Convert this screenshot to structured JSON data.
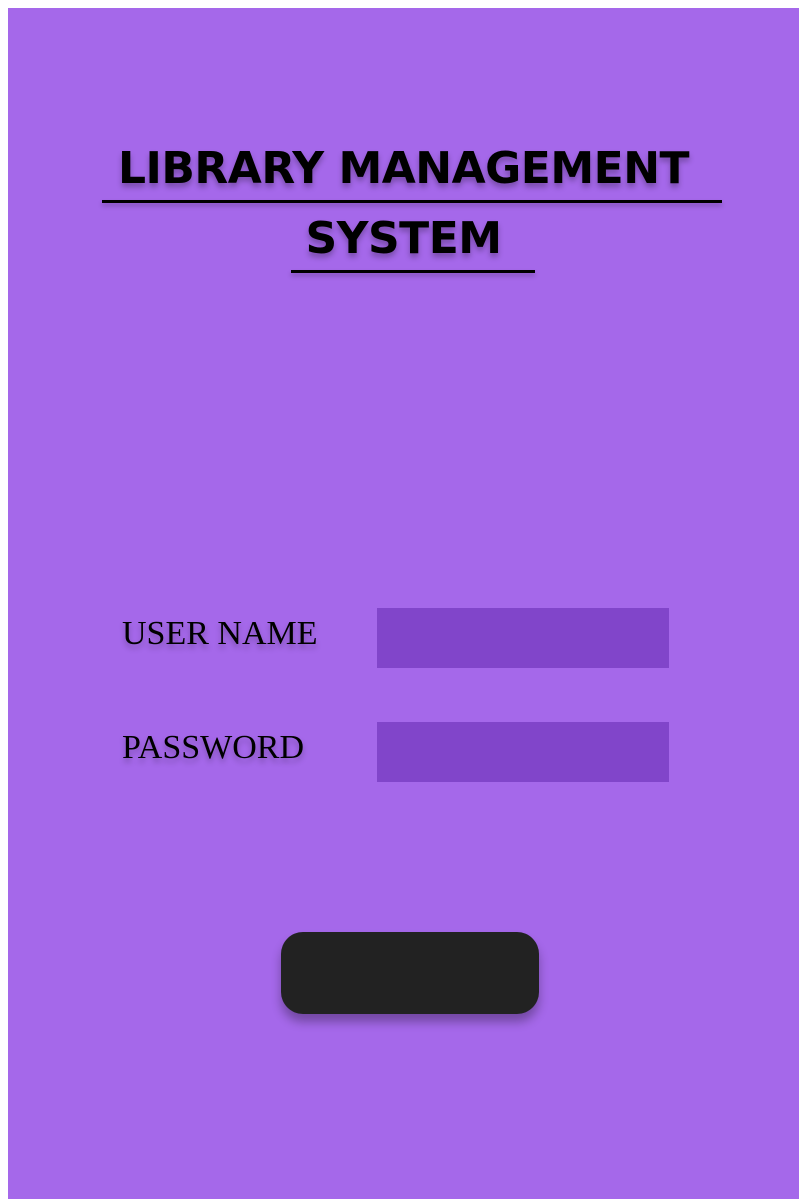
{
  "app": {
    "title_line_1": "LIBRARY MANAGEMENT",
    "title_line_2": "SYSTEM"
  },
  "login_form": {
    "username_label": "USER NAME",
    "username_value": "",
    "password_label": "PASSWORD",
    "password_value": "",
    "submit_label": ""
  },
  "colors": {
    "background": "#a568ea",
    "input_fill": "#8145ca",
    "button_fill": "#222222",
    "text": "#000000"
  }
}
